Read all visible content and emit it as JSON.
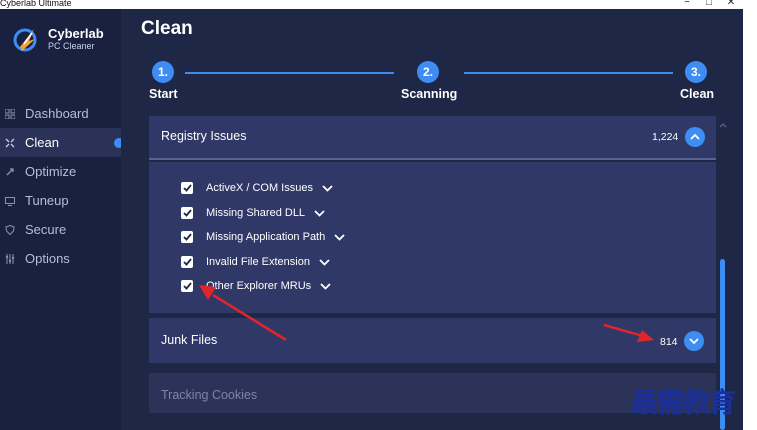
{
  "window": {
    "title": "Cyberlab Ultimate",
    "minimize": "−",
    "maximize": "□",
    "close": "✕"
  },
  "logo": {
    "line1": "Cyberlab",
    "line2": "PC Cleaner"
  },
  "nav": [
    {
      "label": "Dashboard",
      "icon": "dashboard-icon"
    },
    {
      "label": "Clean",
      "icon": "clean-icon"
    },
    {
      "label": "Optimize",
      "icon": "rocket-icon"
    },
    {
      "label": "Tuneup",
      "icon": "tuneup-icon"
    },
    {
      "label": "Secure",
      "icon": "shield-icon"
    },
    {
      "label": "Options",
      "icon": "sliders-icon"
    }
  ],
  "page": {
    "title": "Clean"
  },
  "steps": [
    {
      "number": "1.",
      "label": "Start"
    },
    {
      "number": "2.",
      "label": "Scanning"
    },
    {
      "number": "3.",
      "label": "Clean"
    }
  ],
  "registry": {
    "label": "Registry Issues",
    "count": "1,224",
    "items": [
      {
        "label": "ActiveX / COM Issues",
        "checked": true
      },
      {
        "label": "Missing Shared DLL",
        "checked": true
      },
      {
        "label": "Missing Application Path",
        "checked": true
      },
      {
        "label": "Invalid File Extension",
        "checked": true
      },
      {
        "label": "Other Explorer MRUs",
        "checked": true
      }
    ]
  },
  "junk": {
    "label": "Junk Files",
    "count": "814"
  },
  "tracking": {
    "label": "Tracking Cookies"
  },
  "watermark": "最需教育",
  "colors": {
    "accent": "#3d8df5",
    "sidebar": "#1a2140",
    "panel": "#2f3866",
    "annotation": "#e0262b"
  }
}
